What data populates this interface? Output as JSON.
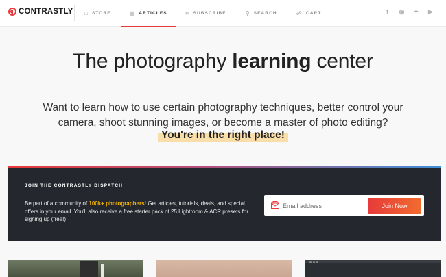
{
  "header": {
    "logo_text": "CONTRASTLY",
    "nav": [
      {
        "label": "STORE",
        "icon": "store-icon"
      },
      {
        "label": "ARTICLES",
        "icon": "articles-icon",
        "active": true
      },
      {
        "label": "SUBSCRIBE",
        "icon": "envelope-icon"
      },
      {
        "label": "SEARCH",
        "icon": "search-icon"
      },
      {
        "label": "CART",
        "icon": "cart-icon"
      }
    ],
    "social": [
      "facebook-icon",
      "instagram-icon",
      "twitter-icon",
      "youtube-icon"
    ]
  },
  "hero": {
    "title_light": "The photography ",
    "title_bold": "learning",
    "title_end": " center",
    "subtitle": "Want to learn how to use certain photography techniques, better control your camera, shoot stunning images, or become a master of photo editing?",
    "cta": "You're in the right place!"
  },
  "dispatch": {
    "title": "JOIN THE CONTRASTLY DISPATCH",
    "body_pre": "Be part of a community of ",
    "body_highlight": "100k+ photographers!",
    "body_post": " Get articles, tutorials, deals, and special offers in your email. You'll also receive a free starter pack of 25 Lightroom & ACR presets for signing up (free!)",
    "email_placeholder": "Email address",
    "button_label": "Join Now"
  },
  "colors": {
    "accent": "#e8393a",
    "dark_panel": "#24272d",
    "highlight": "#f5b400"
  }
}
